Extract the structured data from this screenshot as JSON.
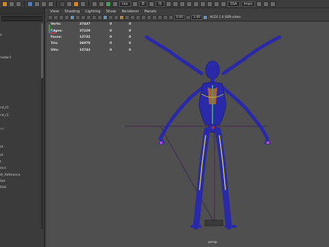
{
  "shelf": {
    "field1": "Isio",
    "field2": "IE",
    "field3": "IS",
    "field4": "SSA",
    "field5": "Impo"
  },
  "outliner": {
    "items": [
      {
        "label": "o"
      },
      {
        "label": "nodar3"
      },
      {
        "label": "nd_t1"
      },
      {
        "label": "nd_r1"
      },
      {
        "label": "ed"
      },
      {
        "label": "ot"
      },
      {
        "label": "ot"
      },
      {
        "label": "t"
      },
      {
        "label": "ecci"
      },
      {
        "label": "th_Reference"
      },
      {
        "label": "Set"
      },
      {
        "label": "tSet"
      }
    ]
  },
  "panel_menu": [
    "View",
    "Shading",
    "Lighting",
    "Show",
    "Renderer",
    "Panels"
  ],
  "panel_toolbar": {
    "field1": "0.00",
    "field2": "1.00",
    "color_space": "ACES 1.0 SDR-video"
  },
  "hud": [
    {
      "label": "Verts:",
      "v1": "37437",
      "v2": "0",
      "v3": "0"
    },
    {
      "label": "Edges:",
      "v1": "37229",
      "v2": "0",
      "v3": "0"
    },
    {
      "label": "Faces:",
      "v1": "13732",
      "v2": "0",
      "v3": "0"
    },
    {
      "label": "Tris:",
      "v1": "26970",
      "v2": "0",
      "v3": "0"
    },
    {
      "label": "UVs:",
      "v1": "15743",
      "v2": "0",
      "v3": "0"
    }
  ],
  "viewport": {
    "camera": "persp",
    "wire_color": "#2a2aa8",
    "bg_color": "#4f4f4f"
  }
}
